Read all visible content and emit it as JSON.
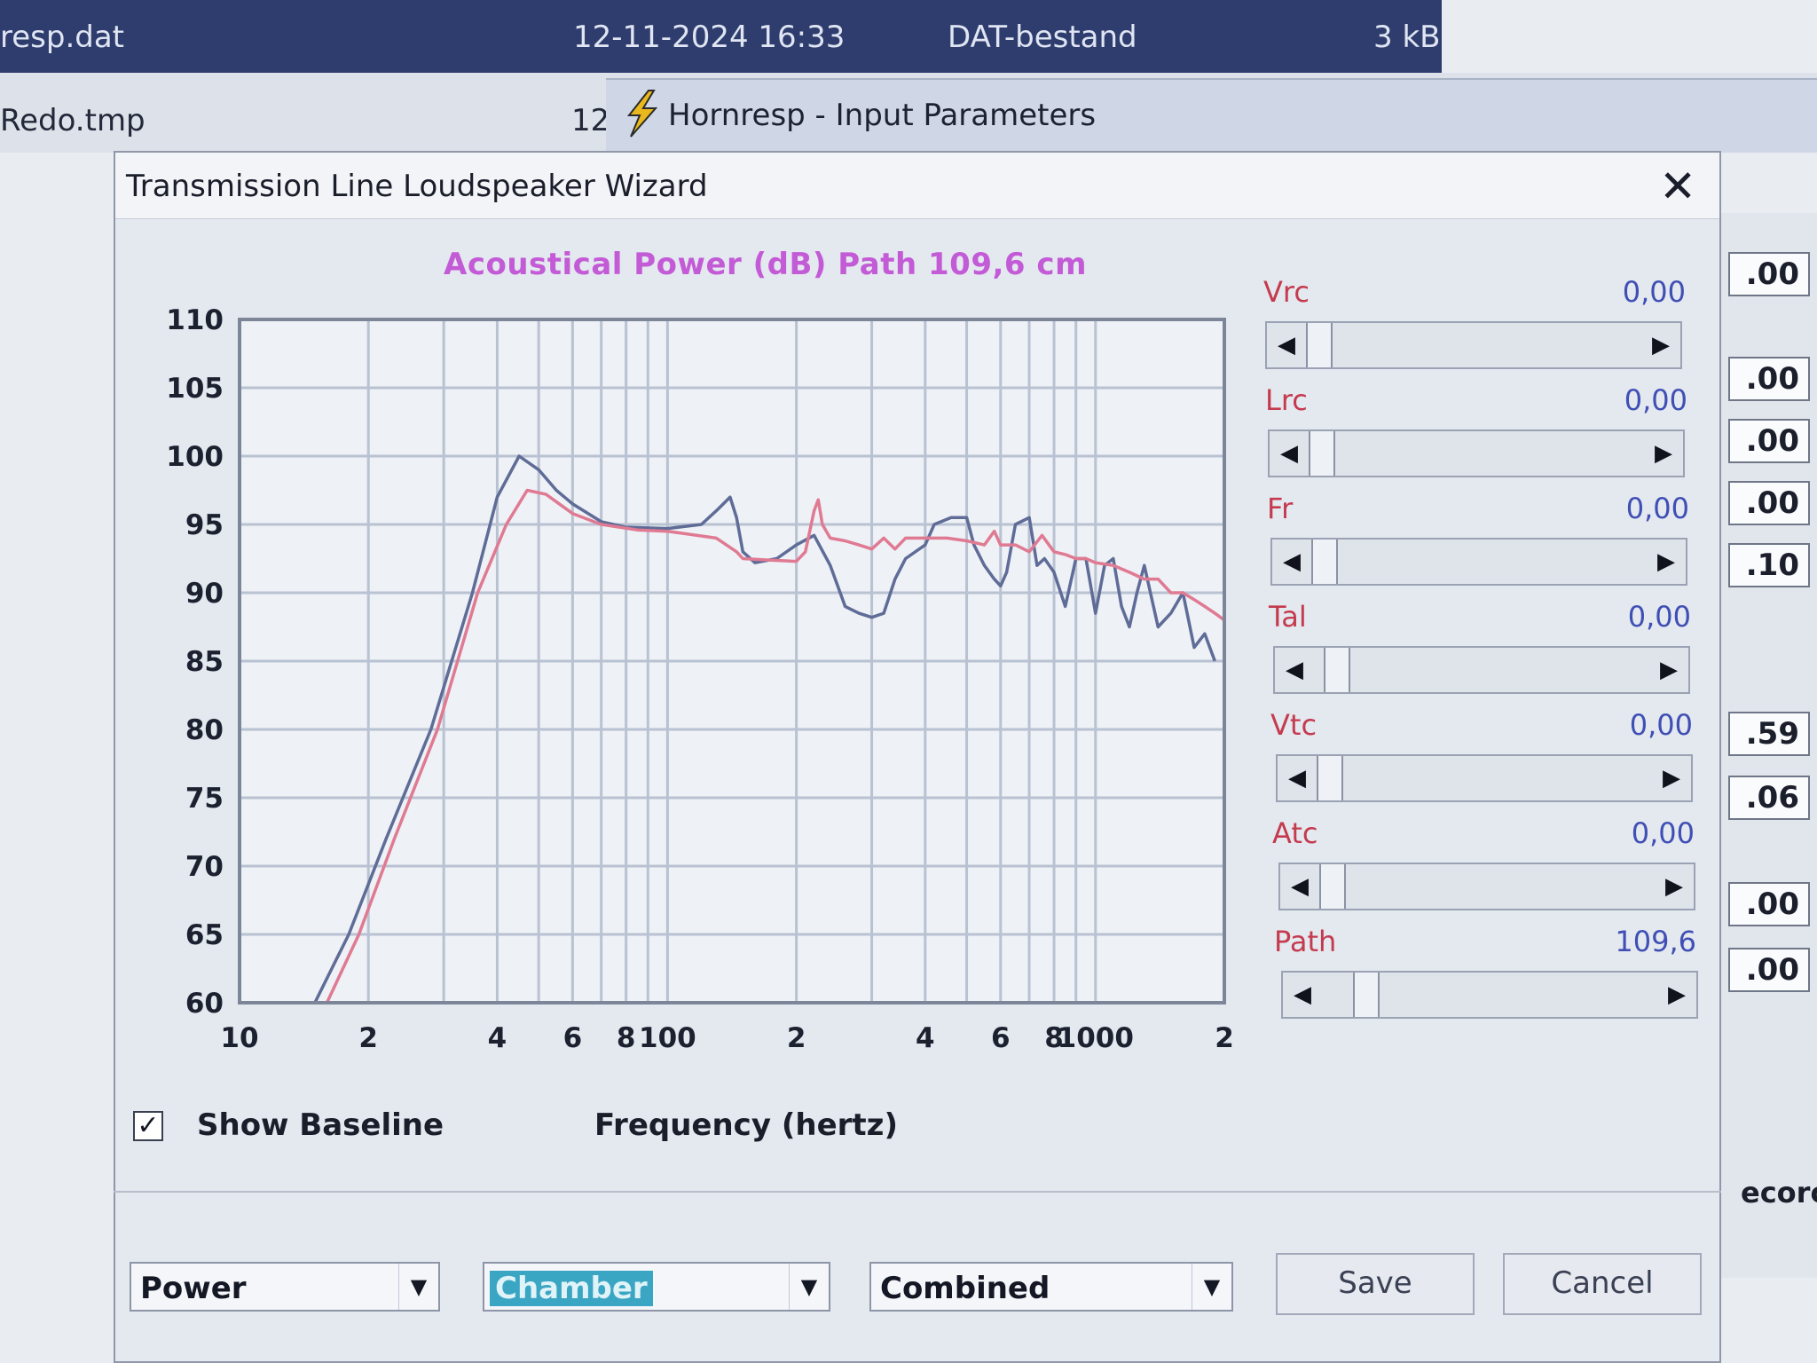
{
  "background": {
    "row1": {
      "name": "resp.dat",
      "date": "12-11-2024 16:33",
      "type": "DAT-bestand",
      "size": "3 kB"
    },
    "row2": {
      "name": "Redo.tmp",
      "date_partial": "12"
    },
    "hornresp_title": "Hornresp - Input Parameters",
    "right_fields": [
      ".00",
      ".00",
      ".00",
      ".00",
      ".10",
      ".59",
      ".06",
      ".00",
      ".00"
    ],
    "right_record": "ecorc"
  },
  "dialog": {
    "title": "Transmission Line Loudspeaker Wizard",
    "close_glyph": "✕"
  },
  "chart_title": "Acoustical Power (dB)   Path 109,6 cm",
  "chart_data": {
    "type": "line",
    "title": "Acoustical Power (dB)   Path 109,6 cm",
    "xlabel": "Frequency (hertz)",
    "ylabel": "",
    "x_scale": "log",
    "xlim": [
      10,
      2000
    ],
    "ylim": [
      60,
      110
    ],
    "y_ticks": [
      110,
      105,
      100,
      95,
      90,
      85,
      80,
      75,
      70,
      65,
      60
    ],
    "x_ticks": [
      {
        "value": 10,
        "label": "10"
      },
      {
        "value": 20,
        "label": "2"
      },
      {
        "value": 40,
        "label": "4"
      },
      {
        "value": 60,
        "label": "6"
      },
      {
        "value": 80,
        "label": "8"
      },
      {
        "value": 100,
        "label": "100"
      },
      {
        "value": 200,
        "label": "2"
      },
      {
        "value": 400,
        "label": "4"
      },
      {
        "value": 600,
        "label": "6"
      },
      {
        "value": 800,
        "label": "8"
      },
      {
        "value": 1000,
        "label": "1000"
      },
      {
        "value": 2000,
        "label": "2"
      }
    ],
    "grid": true,
    "series": [
      {
        "color": "#5e6c97",
        "points": [
          [
            15,
            60
          ],
          [
            18,
            65
          ],
          [
            22,
            72
          ],
          [
            28,
            80
          ],
          [
            35,
            90
          ],
          [
            40,
            97
          ],
          [
            45,
            100
          ],
          [
            50,
            99
          ],
          [
            55,
            97.5
          ],
          [
            60,
            96.5
          ],
          [
            70,
            95.2
          ],
          [
            80,
            94.8
          ],
          [
            100,
            94.7
          ],
          [
            120,
            95
          ],
          [
            130,
            96
          ],
          [
            140,
            97
          ],
          [
            145,
            95.5
          ],
          [
            150,
            93
          ],
          [
            160,
            92.2
          ],
          [
            180,
            92.5
          ],
          [
            200,
            93.5
          ],
          [
            220,
            94.2
          ],
          [
            240,
            92
          ],
          [
            260,
            89
          ],
          [
            280,
            88.5
          ],
          [
            300,
            88.2
          ],
          [
            320,
            88.5
          ],
          [
            340,
            91
          ],
          [
            360,
            92.5
          ],
          [
            400,
            93.5
          ],
          [
            420,
            95
          ],
          [
            460,
            95.5
          ],
          [
            500,
            95.5
          ],
          [
            520,
            93.5
          ],
          [
            550,
            92
          ],
          [
            580,
            91
          ],
          [
            600,
            90.5
          ],
          [
            620,
            91.5
          ],
          [
            650,
            95
          ],
          [
            700,
            95.5
          ],
          [
            730,
            92
          ],
          [
            760,
            92.5
          ],
          [
            800,
            91.5
          ],
          [
            850,
            89
          ],
          [
            900,
            92.5
          ],
          [
            950,
            92.5
          ],
          [
            1000,
            88.5
          ],
          [
            1050,
            92
          ],
          [
            1100,
            92.5
          ],
          [
            1150,
            89
          ],
          [
            1200,
            87.5
          ],
          [
            1250,
            90
          ],
          [
            1300,
            92
          ],
          [
            1400,
            87.5
          ],
          [
            1500,
            88.5
          ],
          [
            1600,
            90
          ],
          [
            1700,
            86
          ],
          [
            1800,
            87
          ],
          [
            1900,
            85
          ]
        ]
      },
      {
        "color": "#e07a93",
        "points": [
          [
            16,
            60
          ],
          [
            19,
            65
          ],
          [
            23,
            72
          ],
          [
            29,
            80
          ],
          [
            36,
            90
          ],
          [
            42,
            95
          ],
          [
            47,
            97.5
          ],
          [
            52,
            97.2
          ],
          [
            60,
            95.8
          ],
          [
            70,
            95
          ],
          [
            85,
            94.6
          ],
          [
            100,
            94.5
          ],
          [
            130,
            94
          ],
          [
            145,
            93
          ],
          [
            150,
            92.5
          ],
          [
            170,
            92.4
          ],
          [
            200,
            92.3
          ],
          [
            210,
            93
          ],
          [
            220,
            96
          ],
          [
            225,
            96.8
          ],
          [
            230,
            95
          ],
          [
            240,
            94
          ],
          [
            260,
            93.8
          ],
          [
            280,
            93.5
          ],
          [
            300,
            93.2
          ],
          [
            320,
            94
          ],
          [
            340,
            93.2
          ],
          [
            360,
            94
          ],
          [
            400,
            94
          ],
          [
            450,
            94
          ],
          [
            500,
            93.8
          ],
          [
            550,
            93.5
          ],
          [
            580,
            94.5
          ],
          [
            600,
            93.5
          ],
          [
            650,
            93.5
          ],
          [
            700,
            93
          ],
          [
            750,
            94.2
          ],
          [
            800,
            93
          ],
          [
            850,
            92.8
          ],
          [
            900,
            92.5
          ],
          [
            950,
            92.5
          ],
          [
            1000,
            92.2
          ],
          [
            1100,
            92
          ],
          [
            1200,
            91.5
          ],
          [
            1300,
            91
          ],
          [
            1400,
            91
          ],
          [
            1500,
            90
          ],
          [
            1600,
            90
          ],
          [
            1700,
            89.5
          ],
          [
            1800,
            89
          ],
          [
            1900,
            88.5
          ],
          [
            2000,
            88
          ]
        ]
      }
    ]
  },
  "controls": {
    "show_baseline_label": "Show Baseline",
    "show_baseline_checked": true,
    "x_axis_label": "Frequency (hertz)"
  },
  "params": [
    {
      "label": "Vrc",
      "value": "0,00",
      "position": 0.0
    },
    {
      "label": "Lrc",
      "value": "0,00",
      "position": 0.0
    },
    {
      "label": "Fr",
      "value": "0,00",
      "position": 0.0
    },
    {
      "label": "Tal",
      "value": "0,00",
      "position": 0.03
    },
    {
      "label": "Vtc",
      "value": "0,00",
      "position": 0.0
    },
    {
      "label": "Atc",
      "value": "0,00",
      "position": 0.0
    },
    {
      "label": "Path",
      "value": "109,6",
      "position": 0.1
    }
  ],
  "bottom": {
    "combo1": "Power",
    "combo2": "Chamber",
    "combo3": "Combined",
    "save": "Save",
    "cancel": "Cancel",
    "dropdown_glyph": "▼"
  }
}
